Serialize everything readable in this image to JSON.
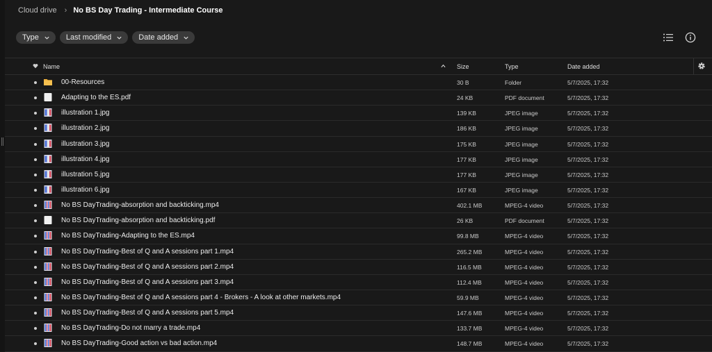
{
  "breadcrumb": {
    "root": "Cloud drive",
    "current": "No BS Day Trading - Intermediate Course"
  },
  "filters": [
    {
      "label": "Type"
    },
    {
      "label": "Last modified"
    },
    {
      "label": "Date added"
    }
  ],
  "columns": {
    "name": "Name",
    "size": "Size",
    "type": "Type",
    "date": "Date added"
  },
  "colors": {
    "folder": "#f2b33d",
    "video_red": "#d94c5c",
    "video_blue": "#4a6fd6",
    "accent_bg": "#191919"
  },
  "files": [
    {
      "name": "00-Resources",
      "size": "30 B",
      "type": "Folder",
      "date": "5/7/2025, 17:32",
      "icon": "folder-icon"
    },
    {
      "name": "Adapting to the ES.pdf",
      "size": "24 KB",
      "type": "PDF document",
      "date": "5/7/2025, 17:32",
      "icon": "pdf-icon"
    },
    {
      "name": "illustration 1.jpg",
      "size": "139 KB",
      "type": "JPEG image",
      "date": "5/7/2025, 17:32",
      "icon": "image-thumbnail-icon"
    },
    {
      "name": "illustration 2.jpg",
      "size": "186 KB",
      "type": "JPEG image",
      "date": "5/7/2025, 17:32",
      "icon": "image-thumbnail-icon"
    },
    {
      "name": "illustration 3.jpg",
      "size": "175 KB",
      "type": "JPEG image",
      "date": "5/7/2025, 17:32",
      "icon": "image-thumbnail-icon"
    },
    {
      "name": "illustration 4.jpg",
      "size": "177 KB",
      "type": "JPEG image",
      "date": "5/7/2025, 17:32",
      "icon": "image-thumbnail-icon"
    },
    {
      "name": "illustration 5.jpg",
      "size": "177 KB",
      "type": "JPEG image",
      "date": "5/7/2025, 17:32",
      "icon": "image-thumbnail-icon"
    },
    {
      "name": "illustration 6.jpg",
      "size": "167 KB",
      "type": "JPEG image",
      "date": "5/7/2025, 17:32",
      "icon": "image-thumbnail-icon"
    },
    {
      "name": "No BS DayTrading-absorption and backticking.mp4",
      "size": "402.1 MB",
      "type": "MPEG-4 video",
      "date": "5/7/2025, 17:32",
      "icon": "video-thumbnail-icon"
    },
    {
      "name": "No BS DayTrading-absorption and backticking.pdf",
      "size": "26 KB",
      "type": "PDF document",
      "date": "5/7/2025, 17:32",
      "icon": "pdf-icon"
    },
    {
      "name": "No BS DayTrading-Adapting to the ES.mp4",
      "size": "99.8 MB",
      "type": "MPEG-4 video",
      "date": "5/7/2025, 17:32",
      "icon": "video-thumbnail-icon"
    },
    {
      "name": "No BS DayTrading-Best of Q and A sessions part 1.mp4",
      "size": "265.2 MB",
      "type": "MPEG-4 video",
      "date": "5/7/2025, 17:32",
      "icon": "video-thumbnail-icon"
    },
    {
      "name": "No BS DayTrading-Best of Q and A sessions part 2.mp4",
      "size": "116.5 MB",
      "type": "MPEG-4 video",
      "date": "5/7/2025, 17:32",
      "icon": "video-thumbnail-icon"
    },
    {
      "name": "No BS DayTrading-Best of Q and A sessions part 3.mp4",
      "size": "112.4 MB",
      "type": "MPEG-4 video",
      "date": "5/7/2025, 17:32",
      "icon": "video-thumbnail-icon"
    },
    {
      "name": "No BS DayTrading-Best of Q and A sessions part 4 - Brokers - A look at other markets.mp4",
      "size": "59.9 MB",
      "type": "MPEG-4 video",
      "date": "5/7/2025, 17:32",
      "icon": "video-thumbnail-icon"
    },
    {
      "name": "No BS DayTrading-Best of Q and A sessions part 5.mp4",
      "size": "147.6 MB",
      "type": "MPEG-4 video",
      "date": "5/7/2025, 17:32",
      "icon": "video-thumbnail-icon"
    },
    {
      "name": "No BS DayTrading-Do not marry a trade.mp4",
      "size": "133.7 MB",
      "type": "MPEG-4 video",
      "date": "5/7/2025, 17:32",
      "icon": "video-thumbnail-icon"
    },
    {
      "name": "No BS DayTrading-Good action vs bad action.mp4",
      "size": "148.7 MB",
      "type": "MPEG-4 video",
      "date": "5/7/2025, 17:32",
      "icon": "video-thumbnail-icon"
    }
  ]
}
